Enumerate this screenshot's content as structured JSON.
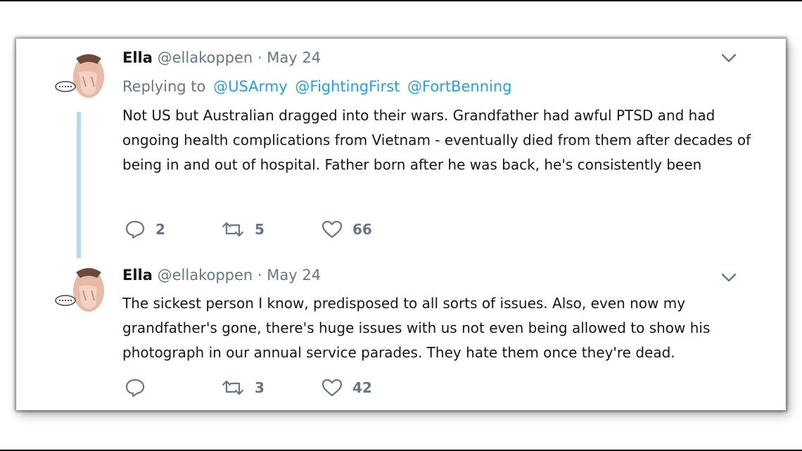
{
  "tweets": [
    {
      "name": "Ella",
      "handle": "@ellakoppen",
      "separator": "·",
      "date": "May 24",
      "replying_label": "Replying to",
      "mentions": [
        "@USArmy",
        "@FightingFirst",
        "@FortBenning"
      ],
      "text": "Not US but Australian dragged into their wars. Grandfather had awful PTSD and had ongoing health complications from Vietnam - eventually died from them after decades of being in and out of hospital. Father born after he was back, he's consistently been",
      "replies": "2",
      "retweets": "5",
      "likes": "66",
      "icons": {
        "reply": "reply-icon",
        "retweet": "retweet-icon",
        "like": "heart-icon",
        "more": "chevron-down-icon"
      }
    },
    {
      "name": "Ella",
      "handle": "@ellakoppen",
      "separator": "·",
      "date": "May 24",
      "text": "The sickest person I know, predisposed to all sorts of issues. Also, even now my grandfather's gone, there's huge issues with us not even being allowed to show his photograph in our annual service parades. They hate them once they're dead.",
      "replies": "",
      "retweets": "3",
      "likes": "42",
      "icons": {
        "reply": "reply-icon",
        "retweet": "retweet-icon",
        "like": "heart-icon",
        "more": "chevron-down-icon"
      }
    }
  ],
  "colors": {
    "text": "#14171a",
    "muted": "#657786",
    "link": "#1da1f2",
    "thread_line": "#b2dcea"
  }
}
